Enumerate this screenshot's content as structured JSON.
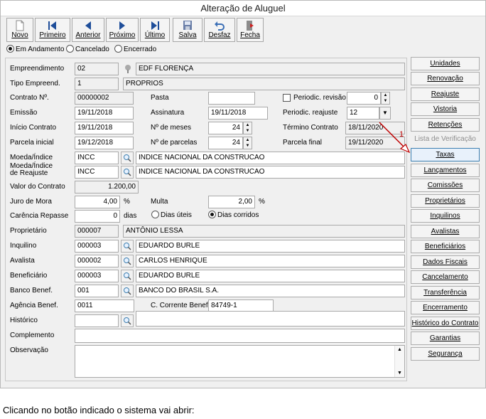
{
  "window": {
    "title": "Alteração de Aluguel"
  },
  "toolbar": [
    {
      "label": "Novo",
      "icon": "new-document-icon"
    },
    {
      "label": "Primeiro",
      "icon": "first-record-icon"
    },
    {
      "label": "Anterior",
      "icon": "previous-record-icon"
    },
    {
      "label": "Próximo",
      "icon": "next-record-icon"
    },
    {
      "label": "Último",
      "icon": "last-record-icon"
    },
    {
      "label": "Salva",
      "icon": "save-icon"
    },
    {
      "label": "Desfaz",
      "icon": "undo-icon"
    },
    {
      "label": "Fecha",
      "icon": "exit-icon"
    }
  ],
  "status_filter": {
    "options": [
      "Em Andamento",
      "Cancelado",
      "Encerrado"
    ],
    "selected": "Em Andamento"
  },
  "form": {
    "empreendimento": {
      "label": "Empreendimento",
      "code": "02",
      "name": "EDF FLORENÇA"
    },
    "tipo_empreend": {
      "label": "Tipo Empreend.",
      "code": "1",
      "name": "PROPRIOS"
    },
    "contrato": {
      "label": "Contrato Nº.",
      "value": "00000002"
    },
    "pasta": {
      "label": "Pasta",
      "value": ""
    },
    "periodic_revisao": {
      "label": "Periodic. revisão",
      "checked": false,
      "value": "0"
    },
    "emissao": {
      "label": "Emissão",
      "value": "19/11/2018"
    },
    "assinatura": {
      "label": "Assinatura",
      "value": "19/11/2018"
    },
    "periodic_reajuste": {
      "label": "Periodic. reajuste",
      "value": "12"
    },
    "inicio_contrato": {
      "label": "Início Contrato",
      "value": "19/11/2018"
    },
    "num_meses": {
      "label": "Nº de meses",
      "value": "24"
    },
    "termino_contrato": {
      "label": "Término Contrato",
      "value": "18/11/2020"
    },
    "parcela_inicial": {
      "label": "Parcela inicial",
      "value": "19/12/2018"
    },
    "num_parcelas": {
      "label": "Nº de parcelas",
      "value": "24"
    },
    "parcela_final": {
      "label": "Parcela final",
      "value": "19/11/2020"
    },
    "moeda_indice": {
      "label": "Moeda/Índice",
      "code": "INCC",
      "name": "INDICE NACIONAL DA CONSTRUCAO"
    },
    "moeda_reajuste": {
      "label_line1": "Moeda/Índice",
      "label_line2": "de Reajuste",
      "code": "INCC",
      "name": "INDICE NACIONAL DA CONSTRUCAO"
    },
    "valor_contrato": {
      "label": "Valor do Contrato",
      "value": "1.200,00"
    },
    "juro_mora": {
      "label": "Juro de Mora",
      "value": "4,00",
      "unit": "%"
    },
    "multa": {
      "label": "Multa",
      "value": "2,00",
      "unit": "%"
    },
    "carencia": {
      "label": "Carência Repasse",
      "value": "0",
      "unit": "dias",
      "options": [
        "Dias úteis",
        "Dias corridos"
      ],
      "selected": "Dias corridos"
    },
    "proprietario": {
      "label": "Proprietário",
      "code": "000007",
      "name": "ANTÔNIO LESSA"
    },
    "inquilino": {
      "label": "Inquilino",
      "code": "000003",
      "name": "EDUARDO BURLE"
    },
    "avalista": {
      "label": "Avalista",
      "code": "000002",
      "name": "CARLOS HENRIQUE"
    },
    "beneficiario": {
      "label": "Beneficiário",
      "code": "000003",
      "name": "EDUARDO BURLE"
    },
    "banco_benef": {
      "label": "Banco Benef.",
      "code": "001",
      "name": "BANCO DO BRASIL S.A."
    },
    "agencia_benef": {
      "label": "Agência Benef.",
      "value": "0011"
    },
    "conta_corrente": {
      "label": "C. Corrente Benef.",
      "value": "84749-1"
    },
    "historico": {
      "label": "Histórico",
      "code": "",
      "name": ""
    },
    "complemento": {
      "label": "Complemento",
      "value": ""
    },
    "observacao": {
      "label": "Observação",
      "value": ""
    }
  },
  "side_buttons": [
    "Unidades",
    "Renovação",
    "Reajuste",
    "Vistoria",
    "Retenções",
    "Lista de Verificação",
    "Taxas",
    "Lançamentos",
    "Comissões",
    "Proprietários",
    "Inquilinos",
    "Avalistas",
    "Beneficiários",
    "Dados Fiscais",
    "Cancelamento",
    "Transferência",
    "Encerramento",
    "Histórico do Contrato",
    "Garantias",
    "Segurança"
  ],
  "annotation": {
    "number": "1",
    "color": "#c00000"
  },
  "caption": "Clicando no botão indicado o sistema vai abrir:"
}
